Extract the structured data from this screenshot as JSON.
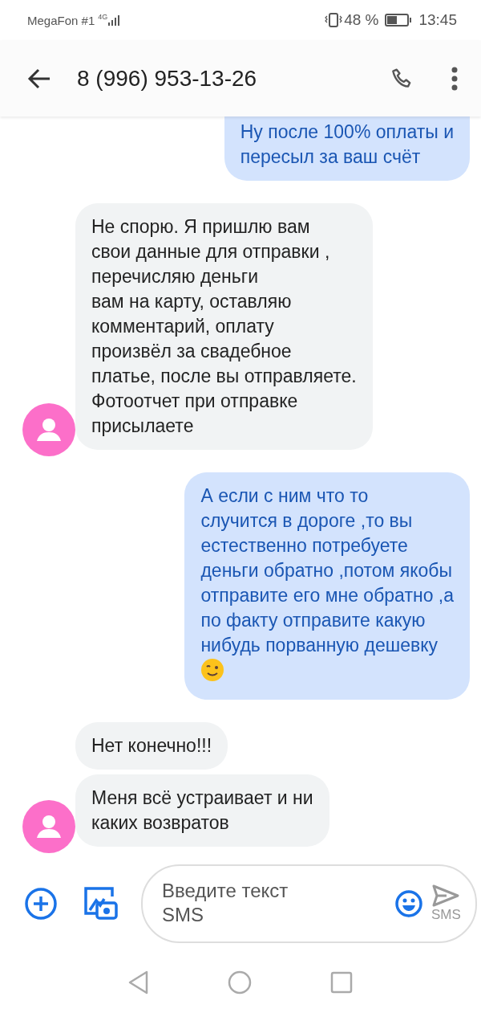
{
  "status_bar": {
    "carrier": "MegaFon #1",
    "network": "4G",
    "battery": "48 %",
    "time": "13:45"
  },
  "header": {
    "contact": "8 (996) 953-13-26"
  },
  "messages": [
    {
      "kind": "outgoing",
      "text": "Ну после 100% оплаты и\nпересыл за ваш счёт",
      "avatar": false,
      "emoji": false
    },
    {
      "kind": "incoming",
      "text": "Не спорю. Я пришлю вам\nсвои данные для отправки ,\nперечисляю деньги\nвам на карту, оставляю\nкомментарий, оплату\nпроизвёл за свадебное\nплатье, после вы отправляете.\nФотоотчет при отправке\nприсылаете",
      "avatar": true,
      "emoji": false
    },
    {
      "kind": "outgoing",
      "text": "А если с ним что то\nслучится в дороге ,то вы\nестественно потребуете\nденьги обратно ,потом якобы\nотправите его мне обратно ,а\nпо факту отправите какую\nнибудь порванную дешевку",
      "avatar": false,
      "emoji": true
    },
    {
      "kind": "incoming",
      "text": "Нет конечно!!!",
      "avatar": false,
      "emoji": false
    },
    {
      "kind": "incoming",
      "text": "Меня всё устраивает и ни\nкаких возвратов",
      "avatar": true,
      "emoji": false
    }
  ],
  "composer": {
    "placeholder": "Введите текст\nSMS",
    "send_label": "SMS"
  }
}
